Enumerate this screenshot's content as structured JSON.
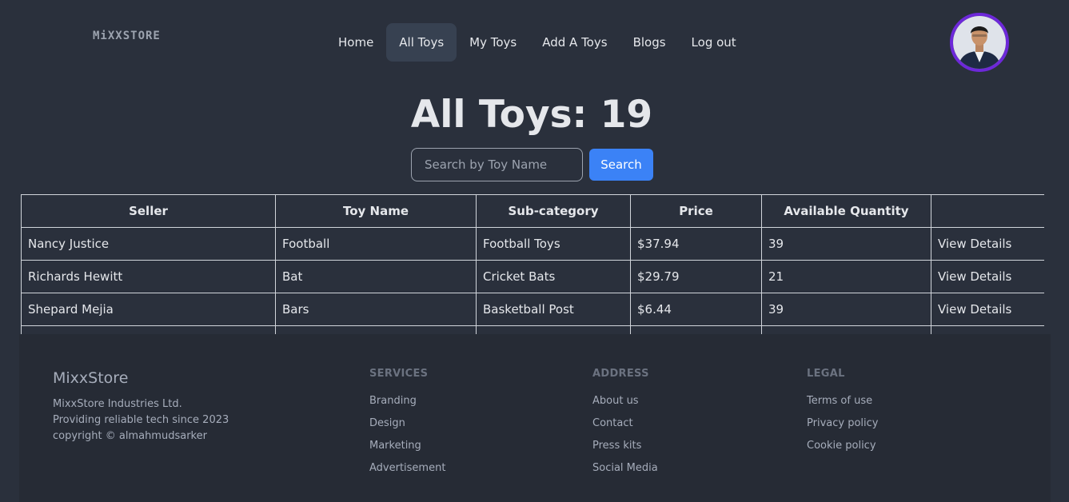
{
  "nav": {
    "logo": "MiXXSTORE",
    "items": [
      {
        "label": "Home",
        "active": false
      },
      {
        "label": "All Toys",
        "active": true
      },
      {
        "label": "My Toys",
        "active": false
      },
      {
        "label": "Add A Toys",
        "active": false
      },
      {
        "label": "Blogs",
        "active": false
      },
      {
        "label": "Log out",
        "active": false
      }
    ],
    "accent_color": "#6d28d9"
  },
  "main": {
    "title": "All Toys: 19",
    "search": {
      "placeholder": "Search by Toy Name",
      "value": "",
      "button_label": "Search",
      "button_color": "#3b82f6"
    }
  },
  "table": {
    "columns": [
      "Seller",
      "Toy Name",
      "Sub-category",
      "Price",
      "Available Quantity",
      ""
    ],
    "rows": [
      {
        "seller": "Nancy Justice",
        "toy": "Football",
        "subcategory": "Football Toys",
        "price": "$37.94",
        "quantity": "39",
        "action": "View Details"
      },
      {
        "seller": "Richards Hewitt",
        "toy": "Bat",
        "subcategory": "Cricket Bats",
        "price": "$29.79",
        "quantity": "21",
        "action": "View Details"
      },
      {
        "seller": "Shepard Mejia",
        "toy": "Bars",
        "subcategory": "Basketball Post",
        "price": "$6.44",
        "quantity": "39",
        "action": "View Details"
      }
    ]
  },
  "footer": {
    "brand": "MixxStore",
    "desc_lines": [
      "MixxStore Industries Ltd.",
      "Providing reliable tech since 2023",
      "copyright © almahmudsarker"
    ],
    "columns": [
      {
        "heading": "SERVICES",
        "links": [
          "Branding",
          "Design",
          "Marketing",
          "Advertisement"
        ]
      },
      {
        "heading": "ADDRESS",
        "links": [
          "About us",
          "Contact",
          "Press kits",
          "Social Media"
        ]
      },
      {
        "heading": "LEGAL",
        "links": [
          "Terms of use",
          "Privacy policy",
          "Cookie policy"
        ]
      }
    ]
  }
}
